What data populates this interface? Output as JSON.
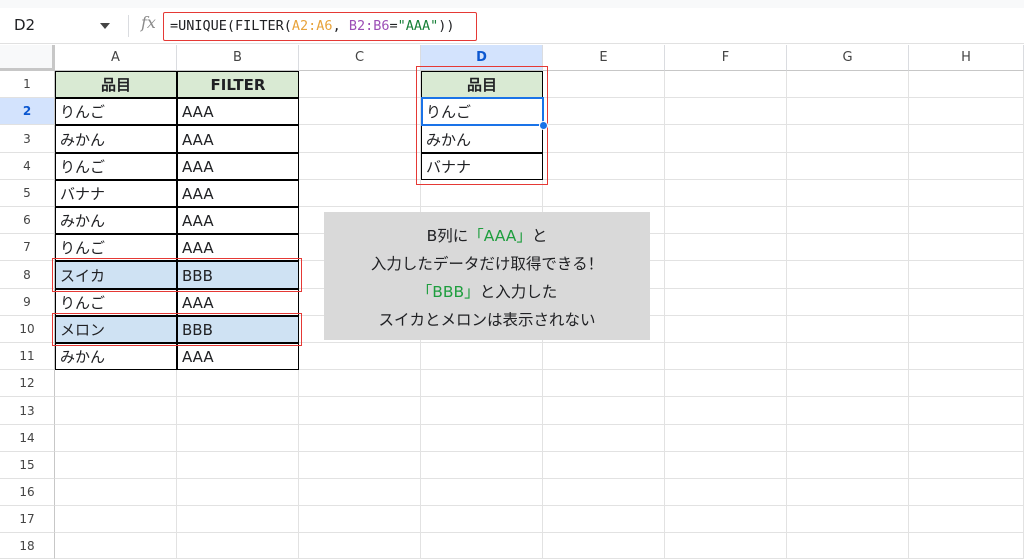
{
  "formula_bar": {
    "cell_ref": "D2",
    "fx_label": "fx",
    "formula_prefix": "=UNIQUE(FILTER(",
    "formula_range_a": "A2:A6",
    "formula_sep": ", ",
    "formula_range_b": "B2:B6",
    "formula_eq": "=",
    "formula_criterion": "\"AAA\"",
    "formula_suffix": "))"
  },
  "columns": [
    "A",
    "B",
    "C",
    "D",
    "E",
    "F",
    "G",
    "H"
  ],
  "selected_column": "D",
  "rows": [
    "1",
    "2",
    "3",
    "4",
    "5",
    "6",
    "7",
    "8",
    "9",
    "10",
    "11",
    "12",
    "13",
    "14",
    "15",
    "16",
    "17",
    "18"
  ],
  "selected_row": "2",
  "table": {
    "headers": [
      "品目",
      "FILTER"
    ],
    "items": [
      [
        "りんご",
        "AAA"
      ],
      [
        "みかん",
        "AAA"
      ],
      [
        "りんご",
        "AAA"
      ],
      [
        "バナナ",
        "AAA"
      ],
      [
        "みかん",
        "AAA"
      ],
      [
        "りんご",
        "AAA"
      ],
      [
        "スイカ",
        "BBB"
      ],
      [
        "りんご",
        "AAA"
      ],
      [
        "メロン",
        "BBB"
      ],
      [
        "みかん",
        "AAA"
      ]
    ]
  },
  "result": {
    "header": "品目",
    "values": [
      "りんご",
      "みかん",
      "バナナ"
    ]
  },
  "note": {
    "l1_a": "B列に",
    "l1_b": "「AAA」",
    "l1_c": "と",
    "l2": "入力したデータだけ取得できる！",
    "l3_a": "「BBB」",
    "l3_b": "と入力した",
    "l4": "スイカとメロンは表示されない"
  },
  "colors": {
    "header_fill": "#d9ead3",
    "highlight_fill": "#cfe2f3",
    "annotation_red": "#e53935",
    "selection_blue": "#1a73e8",
    "note_green": "#1e9e3e"
  }
}
